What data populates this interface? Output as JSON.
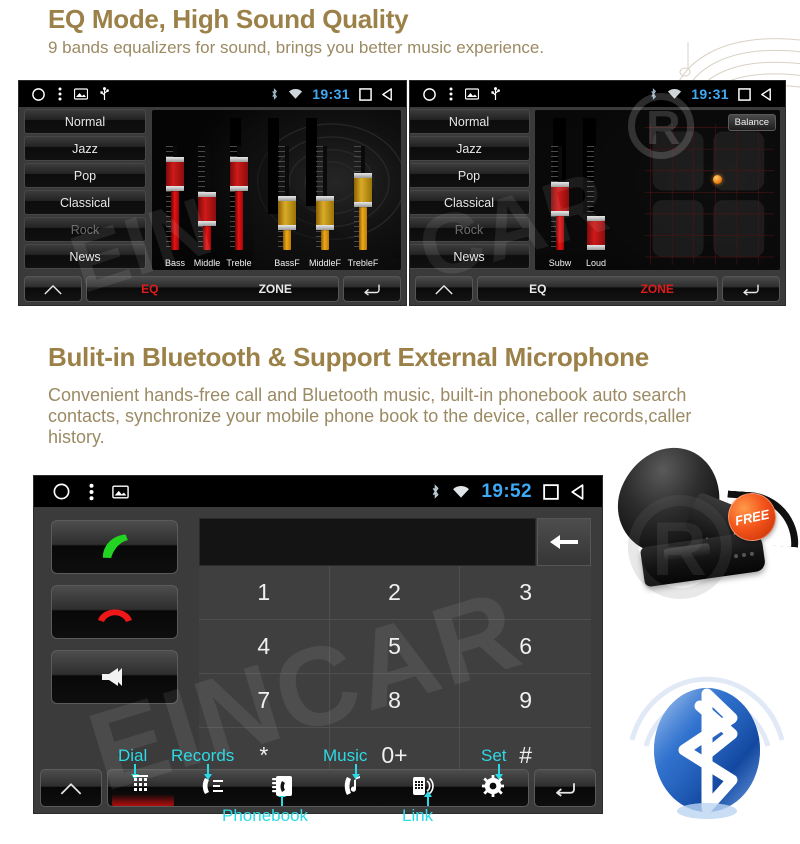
{
  "sections": {
    "eq": {
      "title": "EQ Mode, High Sound Quality",
      "subtitle": "9 bands equalizers for sound, brings you better music experience."
    },
    "bluetooth": {
      "title": "Bulit-in Bluetooth & Support External Microphone",
      "subtitle": "Convenient hands-free call and Bluetooth music, built-in phonebook auto search contacts, synchronize your mobile phone book to the device, caller records,caller history."
    }
  },
  "colors": {
    "heading": "#9b8047",
    "body_text": "#9b8a63",
    "callout": "#2ed9e6",
    "active_red": "#e01b1b",
    "clock_blue": "#3fa9f5",
    "slider_red": "#e51414",
    "slider_amber": "#f0a81a"
  },
  "eq_screen_1": {
    "statusbar": {
      "home_icon": "circle-home-icon",
      "menu_icon": "kebab-menu-icon",
      "gallery_icon": "picture-icon",
      "usb_icon": "usb-icon",
      "bluetooth_icon": "bluetooth-icon",
      "wifi_icon": "wifi-icon",
      "clock": "19:31",
      "recents_icon": "square-recents-icon",
      "back_icon": "triangle-back-icon"
    },
    "presets": [
      {
        "label": "Normal",
        "state": "normal"
      },
      {
        "label": "Jazz",
        "state": "normal"
      },
      {
        "label": "Pop",
        "state": "normal"
      },
      {
        "label": "Classical",
        "state": "normal"
      },
      {
        "label": "Rock",
        "state": "disabled"
      },
      {
        "label": "News",
        "state": "normal"
      }
    ],
    "sliders": [
      {
        "label": "Bass",
        "color": "red",
        "value": 86
      },
      {
        "label": "Middle",
        "color": "red",
        "value": 52
      },
      {
        "label": "Treble",
        "color": "red",
        "value": 86
      },
      {
        "label": "BassF",
        "color": "amber",
        "value": 48
      },
      {
        "label": "MiddleF",
        "color": "amber",
        "value": 48
      },
      {
        "label": "TrebleF",
        "color": "amber",
        "value": 70
      }
    ],
    "nav": {
      "home_icon": "home-icon",
      "tab_left": "EQ",
      "tab_right": "ZONE",
      "active_tab": "EQ",
      "back_icon": "return-icon"
    }
  },
  "eq_screen_2": {
    "statusbar": {
      "home_icon": "circle-home-icon",
      "menu_icon": "kebab-menu-icon",
      "gallery_icon": "picture-icon",
      "usb_icon": "usb-icon",
      "bluetooth_icon": "bluetooth-icon",
      "wifi_icon": "wifi-icon",
      "clock": "19:31",
      "recents_icon": "square-recents-icon",
      "back_icon": "triangle-back-icon"
    },
    "presets": [
      {
        "label": "Normal",
        "state": "normal"
      },
      {
        "label": "Jazz",
        "state": "normal"
      },
      {
        "label": "Pop",
        "state": "normal"
      },
      {
        "label": "Classical",
        "state": "normal"
      },
      {
        "label": "Rock",
        "state": "disabled"
      },
      {
        "label": "News",
        "state": "normal"
      }
    ],
    "balance_button": "Balance",
    "sliders": [
      {
        "label": "Subw",
        "color": "red",
        "value": 62
      },
      {
        "label": "Loud",
        "color": "red",
        "value": 18
      }
    ],
    "nav": {
      "home_icon": "home-icon",
      "tab_left": "EQ",
      "tab_right": "ZONE",
      "active_tab": "ZONE",
      "back_icon": "return-icon"
    }
  },
  "phone_screen": {
    "statusbar": {
      "home_icon": "circle-home-icon",
      "menu_icon": "kebab-menu-icon",
      "gallery_icon": "picture-icon",
      "bluetooth_icon": "bluetooth-icon",
      "wifi_icon": "wifi-icon",
      "clock": "19:52",
      "recents_icon": "square-recents-icon",
      "back_icon": "triangle-back-icon"
    },
    "side_buttons": [
      {
        "name": "answer-call",
        "icon": "handset-green-icon"
      },
      {
        "name": "end-call",
        "icon": "handset-red-icon"
      },
      {
        "name": "mute-audio",
        "icon": "speaker-mute-icon"
      }
    ],
    "number_input_value": "",
    "backspace_icon": "backspace-arrow-icon",
    "keypad": [
      "1",
      "2",
      "3",
      "4",
      "5",
      "6",
      "7",
      "8",
      "9",
      "*",
      "0+",
      "#"
    ],
    "nav": {
      "home_icon": "home-icon",
      "back_icon": "return-icon",
      "items": [
        {
          "icon": "dialpad-icon",
          "label": "Dial",
          "active": true,
          "label_pos": "above"
        },
        {
          "icon": "records-icon",
          "label": "Records",
          "active": false,
          "label_pos": "above"
        },
        {
          "icon": "phonebook-icon",
          "label": "Phonebook",
          "active": false,
          "label_pos": "below"
        },
        {
          "icon": "music-note-phone-icon",
          "label": "Music",
          "active": false,
          "label_pos": "above"
        },
        {
          "icon": "link-phone-icon",
          "label": "Link",
          "active": false,
          "label_pos": "below"
        },
        {
          "icon": "gear-icon",
          "label": "Set",
          "active": false,
          "label_pos": "above"
        }
      ]
    }
  },
  "accessory": {
    "microphone_icon": "external-microphone-image",
    "free_badge": "FREE",
    "bluetooth_logo_icon": "bluetooth-logo-icon"
  },
  "watermarks": {
    "brand": "EINCAR",
    "registered_mark": "R"
  }
}
